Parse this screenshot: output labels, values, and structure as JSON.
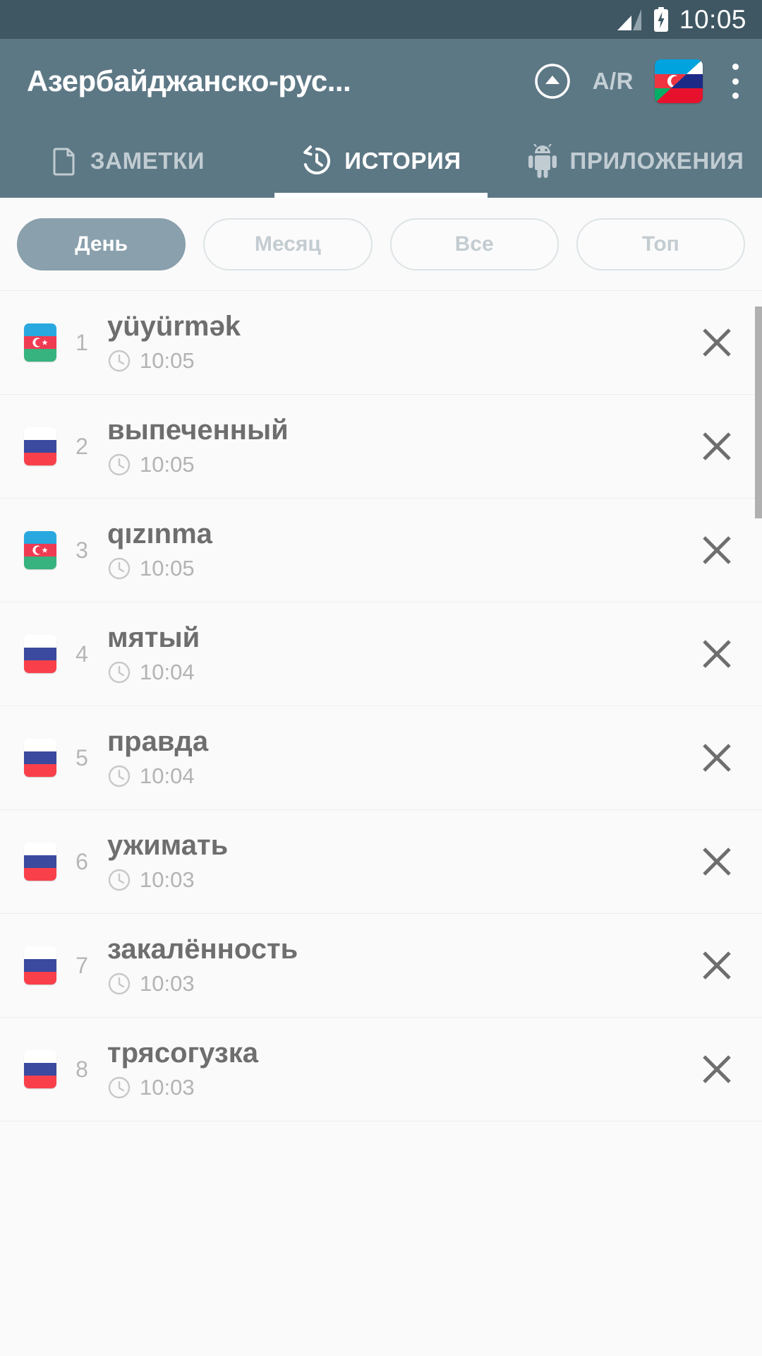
{
  "statusbar": {
    "time": "10:05",
    "signal_icon": "signal-bars-icon",
    "battery_icon": "battery-charging-icon"
  },
  "appbar": {
    "title": "Азербайджанско-рус...",
    "collapse_icon": "collapse-up-circle-icon",
    "direction_label": "A/R",
    "flag_icon": "azerbaijani-russian-flag-icon",
    "overflow_icon": "overflow-menu-icon"
  },
  "tabs": [
    {
      "label": "ЗАМЕТКИ",
      "icon": "notes-icon",
      "active": false
    },
    {
      "label": "ИСТОРИЯ",
      "icon": "history-clock-icon",
      "active": true
    },
    {
      "label": "ПРИЛОЖЕНИЯ",
      "icon": "android-robot-icon",
      "active": false
    }
  ],
  "filters": [
    {
      "label": "День",
      "selected": true
    },
    {
      "label": "Месяц",
      "selected": false
    },
    {
      "label": "Все",
      "selected": false
    },
    {
      "label": "Топ",
      "selected": false
    }
  ],
  "history": {
    "delete_icon": "close-x-icon",
    "clock_icon": "clock-icon",
    "items": [
      {
        "index": "1",
        "word": "yüyürmək",
        "time": "10:05",
        "flag": "azerbaijan-flag-icon"
      },
      {
        "index": "2",
        "word": "выпеченный",
        "time": "10:05",
        "flag": "russia-flag-icon"
      },
      {
        "index": "3",
        "word": "qızınma",
        "time": "10:05",
        "flag": "azerbaijan-flag-icon"
      },
      {
        "index": "4",
        "word": "мятый",
        "time": "10:04",
        "flag": "russia-flag-icon"
      },
      {
        "index": "5",
        "word": "правда",
        "time": "10:04",
        "flag": "russia-flag-icon"
      },
      {
        "index": "6",
        "word": "ужимать",
        "time": "10:03",
        "flag": "russia-flag-icon"
      },
      {
        "index": "7",
        "word": "закалённость",
        "time": "10:03",
        "flag": "russia-flag-icon"
      },
      {
        "index": "8",
        "word": "трясогузка",
        "time": "10:03",
        "flag": "russia-flag-icon"
      }
    ]
  },
  "colors": {
    "statusbar_bg": "#3f5763",
    "appbar_bg": "#5d7885",
    "chip_selected_bg": "#8aa0ac",
    "page_bg": "#fafafa",
    "word_text": "#6e6e6e",
    "muted_text": "#b3b3b3"
  }
}
